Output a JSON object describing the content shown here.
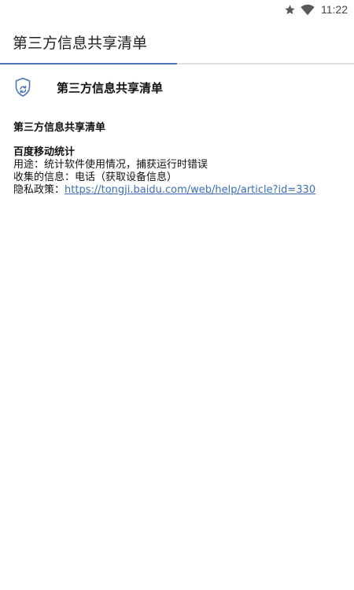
{
  "status_bar": {
    "time": "11:22",
    "icons": [
      "star-icon",
      "wifi-icon"
    ]
  },
  "app_bar": {
    "title": "第三方信息共享清单"
  },
  "header": {
    "icon": "shield-icon",
    "title": "第三方信息共享清单"
  },
  "content": {
    "title": "第三方信息共享清单",
    "sdks": [
      {
        "name": "百度移动统计",
        "purpose_label": "用途：",
        "purpose": "统计软件使用情况，捕获运行时错误",
        "collected_label": "收集的信息：",
        "collected": "电话（获取设备信息）",
        "policy_label": "隐私政策：",
        "policy_url": "https://tongji.baidu.com/web/help/article?id=330"
      }
    ]
  },
  "colors": {
    "accent": "#4a76b8",
    "link": "#3b6fb6",
    "divider": "#e0e0e0"
  }
}
